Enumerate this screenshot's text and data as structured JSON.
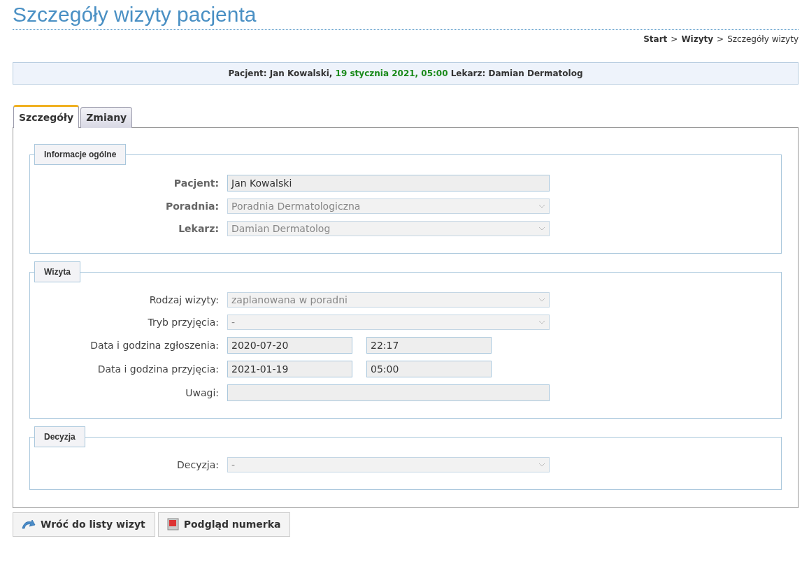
{
  "title": "Szczegóły wizyty pacjenta",
  "breadcrumbs": {
    "separator": ">",
    "items": [
      {
        "label": "Start",
        "current": false
      },
      {
        "label": "Wizyty",
        "current": false
      },
      {
        "label": "Szczegóły wizyty",
        "current": true
      }
    ]
  },
  "info_bar": [
    {
      "text": "Pacjent: Jan Kowalski,",
      "highlight": false
    },
    {
      "text": "19 stycznia 2021, 05:00",
      "highlight": true
    },
    {
      "text": "Lekarz: Damian Dermatolog",
      "highlight": false
    }
  ],
  "tabs": [
    {
      "label": "Szczegóły",
      "selected": true
    },
    {
      "label": "Zmiany",
      "selected": false
    }
  ],
  "sections": [
    {
      "legend": "Informacje ogólne",
      "fields": [
        {
          "kind": "text",
          "label": "Pacjent:",
          "required": true,
          "value": "Jan Kowalski"
        },
        {
          "kind": "select",
          "label": "Poradnia:",
          "required": true,
          "value": "Poradnia Dermatologiczna",
          "disabled": true
        },
        {
          "kind": "select",
          "label": "Lekarz:",
          "required": true,
          "value": "Damian Dermatolog",
          "disabled": true
        }
      ]
    },
    {
      "legend": "Wizyta",
      "fields": [
        {
          "kind": "select",
          "label": "Rodzaj wizyty:",
          "required": false,
          "value": "zaplanowana w poradni",
          "disabled": true
        },
        {
          "kind": "select",
          "label": "Tryb przyjęcia:",
          "required": false,
          "value": "-",
          "disabled": true
        },
        {
          "kind": "datetime",
          "label": "Data i godzina zgłoszenia:",
          "required": false,
          "date": "2020-07-20",
          "time": "22:17"
        },
        {
          "kind": "datetime",
          "label": "Data i godzina przyjęcia:",
          "required": false,
          "date": "2021-01-19",
          "time": "05:00"
        },
        {
          "kind": "text",
          "label": "Uwagi:",
          "required": false
        }
      ]
    },
    {
      "legend": "Decyzja",
      "fields": [
        {
          "kind": "select",
          "label": "Decyzja:",
          "required": false,
          "value": "-",
          "disabled": true
        }
      ]
    }
  ],
  "buttons": [
    {
      "kind": "back",
      "label": "Wróć do listy wizyt"
    },
    {
      "kind": "preview",
      "label": "Podgląd numerka"
    }
  ]
}
